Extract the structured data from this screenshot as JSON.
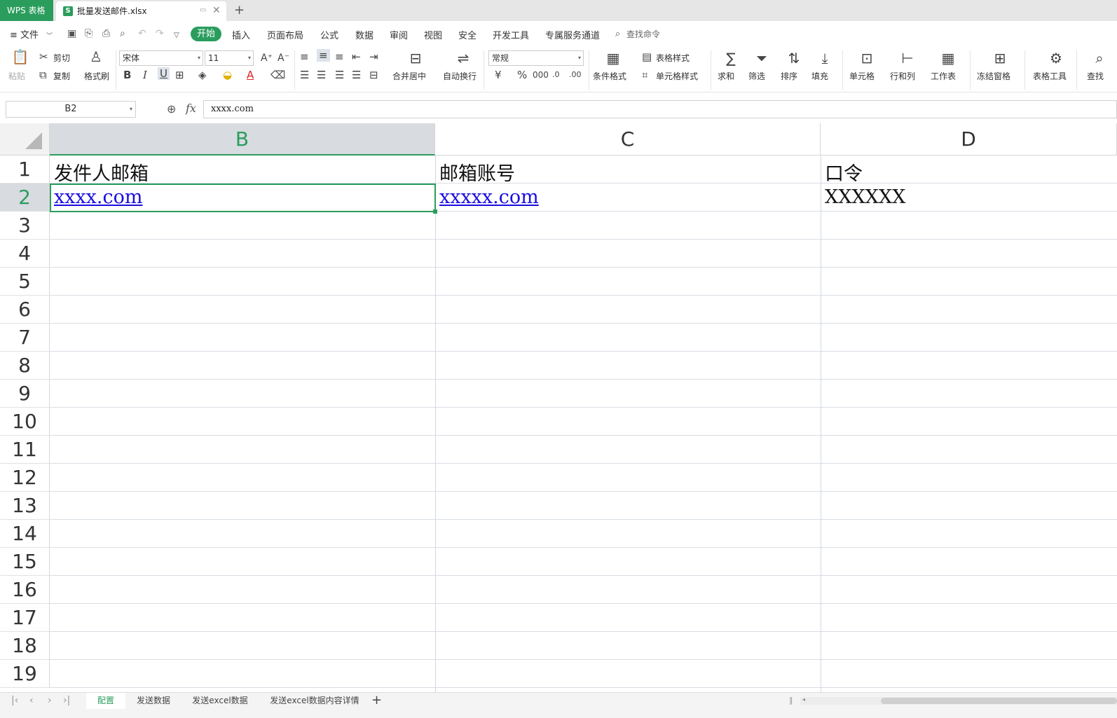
{
  "titlebar": {
    "app_tab": "WPS 表格",
    "doc_icon": "S",
    "doc_name": "批量发送邮件.xlsx",
    "close_glyph": "✕",
    "new_tab_glyph": "+"
  },
  "menubar": {
    "file": "≡ 文件",
    "tabs": [
      "开始",
      "插入",
      "页面布局",
      "公式",
      "数据",
      "审阅",
      "视图",
      "安全",
      "开发工具",
      "专属服务通道"
    ],
    "search": "查找命令"
  },
  "ribbon": {
    "paste": "粘贴",
    "cut": "剪切",
    "copy": "复制",
    "format_painter": "格式刷",
    "font_name": "宋体",
    "font_size": "11",
    "merge_center": "合并居中",
    "wrap_text": "自动换行",
    "number_format": "常规",
    "table_style": "表格样式",
    "conditional_format": "条件格式",
    "cell_style": "单元格样式",
    "sum": "求和",
    "filter": "筛选",
    "sort": "排序",
    "fill": "填充",
    "cell": "单元格",
    "row_col": "行和列",
    "worksheet": "工作表",
    "freeze": "冻结窗格",
    "table_tools": "表格工具",
    "find": "查找",
    "icons": [
      "paste-icon",
      "cut-icon",
      "copy-icon",
      "brush-icon",
      "bold-icon",
      "italic-icon",
      "underline-icon",
      "border-icon",
      "fill-color-icon",
      "font-color-icon",
      "eraser-icon",
      "sum-icon",
      "filter-icon",
      "sort-icon",
      "fill-icon",
      "search-icon"
    ]
  },
  "formula_bar": {
    "name_box": "B2",
    "fx": "fx",
    "value": "xxxx.com"
  },
  "grid": {
    "columns": [
      "B",
      "C",
      "D"
    ],
    "selected_column": "B",
    "rows": [
      "1",
      "2",
      "3",
      "4",
      "5",
      "6",
      "7",
      "8",
      "9",
      "10",
      "11",
      "12",
      "13",
      "14",
      "15",
      "16",
      "17",
      "18",
      "19"
    ],
    "selected_row": "2",
    "cells": {
      "B1": "发件人邮箱",
      "C1": "邮箱账号",
      "D1": "口令",
      "B2": "xxxx.com",
      "C2": "xxxxx.com",
      "D2": "XXXXXX"
    }
  },
  "sheets": {
    "tabs": [
      "配置",
      "发送数据",
      "发送excel数据",
      "发送excel数据内容详情"
    ],
    "active": "配置",
    "add": "+"
  },
  "colors": {
    "accent": "#2a9d5d",
    "link": "#1a0dde",
    "header_selected": "#d8dbe0"
  }
}
